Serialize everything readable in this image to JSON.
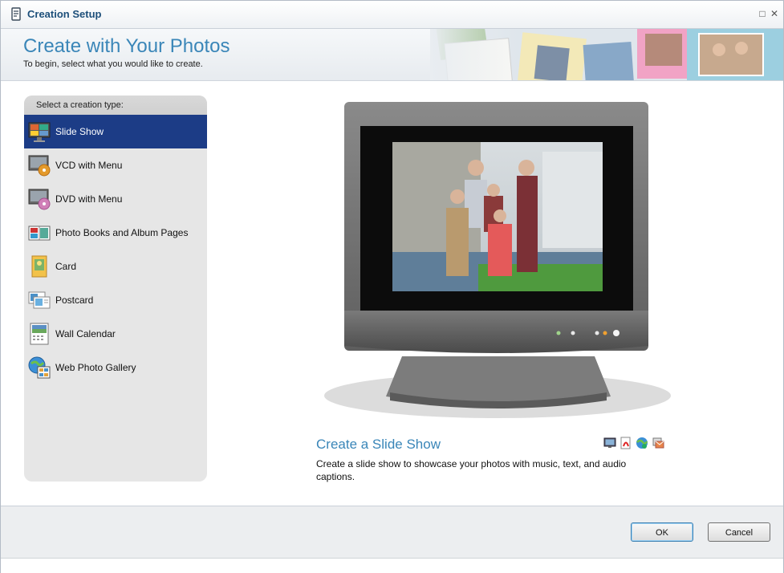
{
  "window": {
    "title": "Creation Setup",
    "maximize_glyph": "□",
    "close_glyph": "✕"
  },
  "header": {
    "title": "Create with Your Photos",
    "subtitle": "To begin, select what you would like to create."
  },
  "sidebar": {
    "heading": "Select a creation type:",
    "items": [
      {
        "label": "Slide Show",
        "icon": "slideshow-icon",
        "selected": true
      },
      {
        "label": "VCD with Menu",
        "icon": "vcd-icon",
        "selected": false
      },
      {
        "label": "DVD with Menu",
        "icon": "dvd-icon",
        "selected": false
      },
      {
        "label": "Photo Books and Album Pages",
        "icon": "photo-book-icon",
        "selected": false
      },
      {
        "label": "Card",
        "icon": "card-icon",
        "selected": false
      },
      {
        "label": "Postcard",
        "icon": "postcard-icon",
        "selected": false
      },
      {
        "label": "Wall Calendar",
        "icon": "calendar-icon",
        "selected": false
      },
      {
        "label": "Web Photo Gallery",
        "icon": "web-gallery-icon",
        "selected": false
      }
    ]
  },
  "detail": {
    "title": "Create a Slide Show",
    "description": "Create a slide show to showcase your photos with music, text, and audio captions.",
    "format_icons": [
      "monitor-icon",
      "pdf-icon",
      "web-icon",
      "email-icon"
    ]
  },
  "buttons": {
    "ok": "OK",
    "cancel": "Cancel"
  },
  "colors": {
    "accent": "#3a86b8",
    "selection": "#1c3c86"
  }
}
